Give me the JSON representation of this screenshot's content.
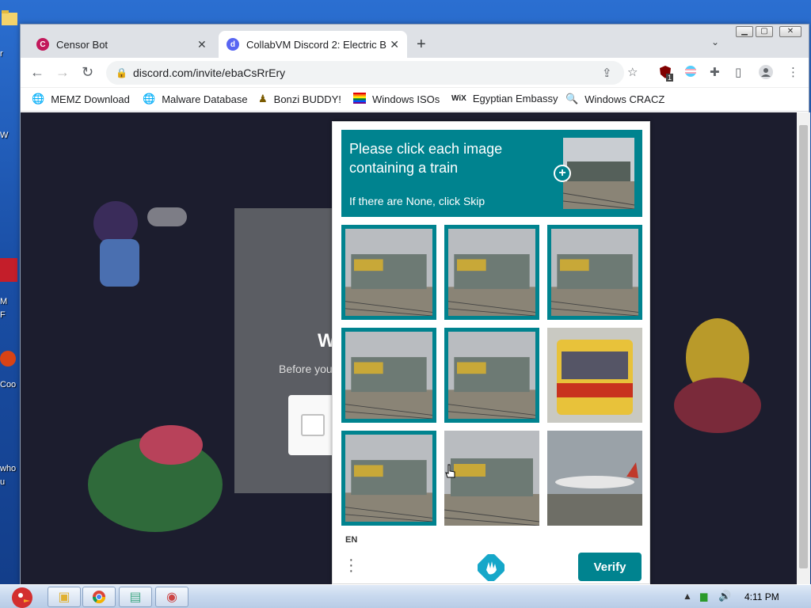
{
  "browser": {
    "tabs": [
      {
        "title": "Censor Bot",
        "active": false
      },
      {
        "title": "CollabVM Discord 2: Electric B",
        "active": true
      }
    ],
    "url": "discord.com/invite/ebaCsRrEry",
    "extension_badge": "1",
    "bookmarks": [
      {
        "label": "MEMZ Download",
        "icon": "globe-icon"
      },
      {
        "label": "Malware Database",
        "icon": "globe-icon"
      },
      {
        "label": "Bonzi BUDDY!",
        "icon": "bonzi-icon"
      },
      {
        "label": "Windows ISOs",
        "icon": "rainbow-flag-icon"
      },
      {
        "label": "Egyptian Embassy",
        "icon": "wix-icon"
      },
      {
        "label": "Windows CRACZ",
        "icon": "search-icon"
      }
    ]
  },
  "discord": {
    "title_fragment": "W",
    "subtitle_fragment": "Before you"
  },
  "captcha": {
    "prompt": "Please click each image containing a train",
    "hint": "If there are None, click Skip",
    "language": "EN",
    "verify_label": "Verify",
    "accent_color": "#00838f",
    "grid": [
      {
        "subject": "train",
        "selected": true
      },
      {
        "subject": "train",
        "selected": true
      },
      {
        "subject": "train",
        "selected": true
      },
      {
        "subject": "train",
        "selected": true
      },
      {
        "subject": "train",
        "selected": true
      },
      {
        "subject": "bus",
        "selected": false
      },
      {
        "subject": "train",
        "selected": true
      },
      {
        "subject": "train",
        "selected": false
      },
      {
        "subject": "airplane",
        "selected": false
      }
    ]
  },
  "desktop": {
    "icon_labels": [
      "r",
      "W",
      "M",
      "F",
      "Coo",
      "who",
      "u"
    ]
  },
  "taskbar": {
    "clock": "4:11 PM"
  }
}
